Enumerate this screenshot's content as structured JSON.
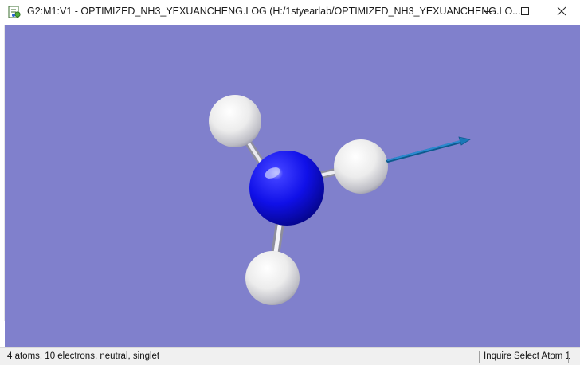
{
  "window": {
    "title": "G2:M1:V1 - OPTIMIZED_NH3_YEXUANCHENG.LOG (H:/1styearlab/OPTIMIZED_NH3_YEXUANCHENG.LO...",
    "app_icon": "gaussview-molecule-icon",
    "controls": {
      "minimize": "minimize-icon",
      "maximize": "maximize-icon",
      "close": "close-icon"
    }
  },
  "viewport": {
    "background": "#8080cc",
    "molecule": {
      "formula": "NH3",
      "atoms": [
        {
          "element": "N",
          "color": "#1010e8"
        },
        {
          "element": "H",
          "color": "#f4f4f4"
        },
        {
          "element": "H",
          "color": "#f4f4f4"
        },
        {
          "element": "H",
          "color": "#f4f4f4"
        }
      ],
      "vector_color": "#1a78b8"
    }
  },
  "statusbar": {
    "summary": "4 atoms, 10 electrons, neutral, singlet",
    "mode": "Inquire",
    "action": "Select Atom 1"
  }
}
